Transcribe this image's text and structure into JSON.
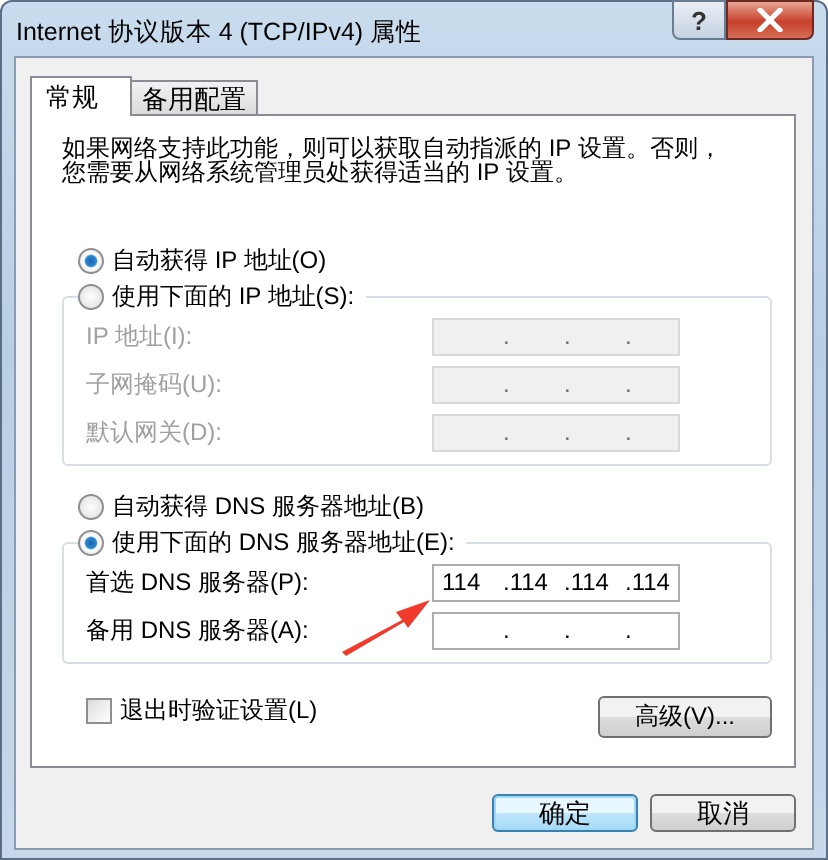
{
  "window": {
    "title": "Internet 协议版本 4 (TCP/IPv4) 属性",
    "help": "?"
  },
  "tabs": [
    {
      "label": "常规",
      "selected": true
    },
    {
      "label": "备用配置",
      "selected": false
    }
  ],
  "description": "如果网络支持此功能，则可以获取自动指派的 IP 设置。否则，您需要从网络系统管理员处获得适当的 IP 设置。",
  "sections": [
    {
      "auto": {
        "label": "自动获得 IP 地址(O)",
        "selected": true
      },
      "manual": {
        "label": "使用下面的 IP 地址(S):",
        "selected": false
      },
      "disabled": true,
      "fields": [
        {
          "label": "IP 地址(I):",
          "parts": [
            ".",
            ".",
            "."
          ]
        },
        {
          "label": "子网掩码(U):",
          "parts": [
            ".",
            ".",
            "."
          ]
        },
        {
          "label": "默认网关(D):",
          "parts": [
            ".",
            ".",
            "."
          ]
        }
      ]
    },
    {
      "auto": {
        "label": "自动获得 DNS 服务器地址(B)",
        "selected": false
      },
      "manual": {
        "label": "使用下面的 DNS 服务器地址(E):",
        "selected": true
      },
      "disabled": false,
      "fields": [
        {
          "label": "首选 DNS 服务器(P):",
          "parts": [
            "114",
            ".114",
            ".114",
            ".114"
          ]
        },
        {
          "label": "备用 DNS 服务器(A):",
          "parts": [
            ".",
            ".",
            "."
          ]
        }
      ]
    }
  ],
  "validate": {
    "label": "退出时验证设置(L)",
    "checked": false
  },
  "advanced_button": "高级(V)...",
  "buttons": [
    {
      "label": "确定",
      "default": true
    },
    {
      "label": "取消",
      "default": false
    }
  ]
}
